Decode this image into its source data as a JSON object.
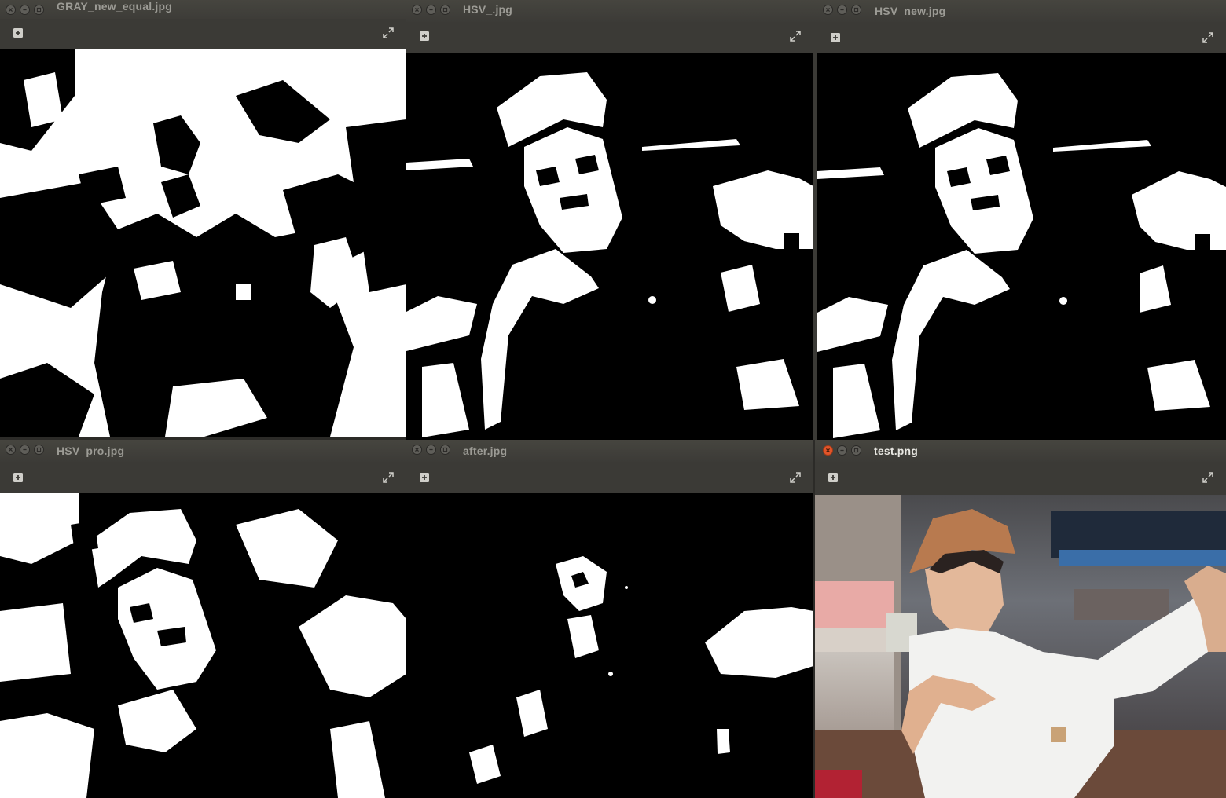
{
  "windows": [
    {
      "id": "w1",
      "title": "GRAY_new_equal.jpg",
      "style": "mostly-white"
    },
    {
      "id": "w2",
      "title": "HSV_.jpg",
      "style": "mask"
    },
    {
      "id": "w3",
      "title": "HSV_new.jpg",
      "style": "mask"
    },
    {
      "id": "w4",
      "title": "HSV_pro.jpg",
      "style": "mask-noisy"
    },
    {
      "id": "w5",
      "title": "after.jpg",
      "style": "sparse"
    },
    {
      "id": "w6",
      "title": "test.png",
      "style": "photo",
      "active": true
    }
  ],
  "icons": {
    "close": "close-icon",
    "minimize": "minimize-icon",
    "maximize": "maximize-icon",
    "add": "add-icon",
    "fullscreen": "fullscreen-icon"
  },
  "colors": {
    "titlebar": "#3c3b37",
    "close_active": "#e2552a",
    "photo_cap": "#b87a4f",
    "photo_shirt": "#f2f2f0"
  }
}
